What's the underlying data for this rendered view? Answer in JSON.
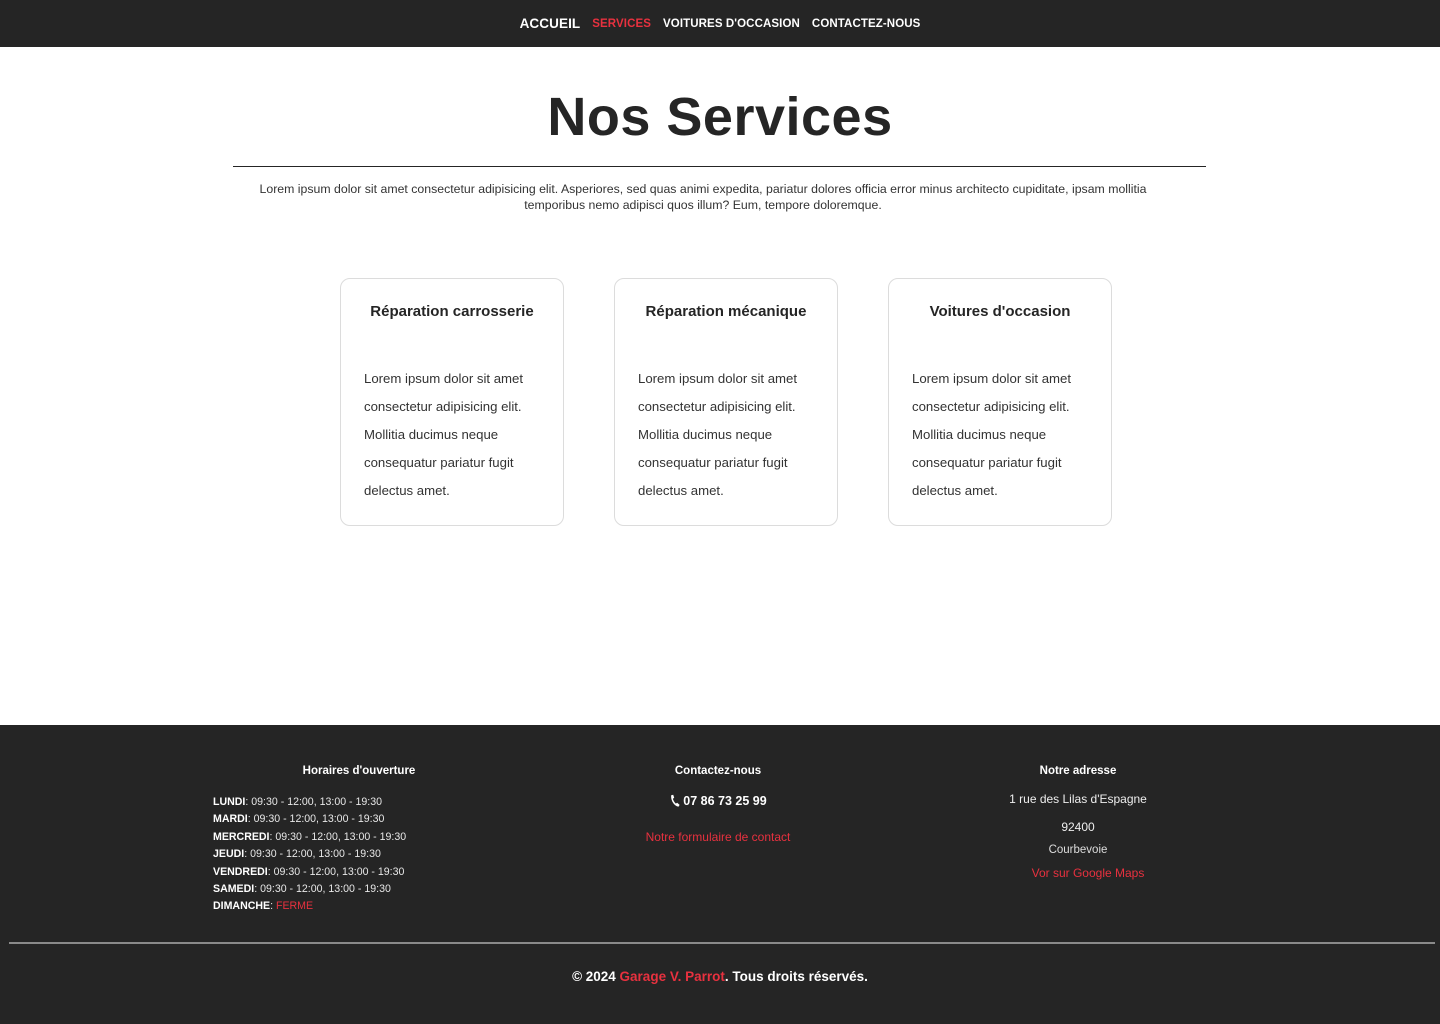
{
  "nav": {
    "items": [
      {
        "label": "ACCUEIL"
      },
      {
        "label": "SERVICES",
        "active": true
      },
      {
        "label": "VOITURES D'OCCASION"
      },
      {
        "label": "CONTACTEZ-NOUS"
      }
    ]
  },
  "hero": {
    "title": "Nos Services",
    "intro": "Lorem ipsum dolor sit amet consectetur adipisicing elit. Asperiores, sed quas animi expedita, pariatur dolores officia error minus architecto cupiditate, ipsam mollitia temporibus nemo adipisci quos illum? Eum, tempore doloremque."
  },
  "services": [
    {
      "title": "Réparation carrosserie",
      "text": "Lorem ipsum dolor sit amet consectetur adipisicing elit. Mollitia ducimus neque consequatur pariatur fugit delectus amet."
    },
    {
      "title": "Réparation mécanique",
      "text": "Lorem ipsum dolor sit amet consectetur adipisicing elit. Mollitia ducimus neque consequatur pariatur fugit delectus amet."
    },
    {
      "title": "Voitures d'occasion",
      "text": "Lorem ipsum dolor sit amet consectetur adipisicing elit. Mollitia ducimus neque consequatur pariatur fugit delectus amet."
    }
  ],
  "footer": {
    "hours": {
      "title": "Horaires d'ouverture",
      "days": [
        {
          "day": "LUNDI",
          "time": "09:30 - 12:00, 13:00 - 19:30"
        },
        {
          "day": "MARDI",
          "time": "09:30 - 12:00, 13:00 - 19:30"
        },
        {
          "day": "MERCREDI",
          "time": "09:30 - 12:00, 13:00 - 19:30"
        },
        {
          "day": "JEUDI",
          "time": "09:30 - 12:00, 13:00 - 19:30"
        },
        {
          "day": "VENDREDI",
          "time": "09:30 - 12:00, 13:00 - 19:30"
        },
        {
          "day": "SAMEDI",
          "time": "09:30 - 12:00, 13:00 - 19:30"
        },
        {
          "day": "DIMANCHE",
          "time": "FERME"
        }
      ]
    },
    "contact": {
      "title": "Contactez-nous",
      "phone": "07 86 73 25 99",
      "phone_icon": "phone-icon",
      "form_link": "Notre formulaire de contact"
    },
    "address": {
      "title": "Notre adresse",
      "street": "1 rue des Lilas d'Espagne",
      "postal": "92400",
      "city": "Courbevoie",
      "maps_link": "Vor sur Google Maps"
    },
    "copyright": {
      "prefix": "© 2024 ",
      "brand": "Garage V. Parrot",
      "suffix": ". Tous droits réservés."
    }
  },
  "colors": {
    "dark": "#252525",
    "accent": "#e8313f"
  }
}
